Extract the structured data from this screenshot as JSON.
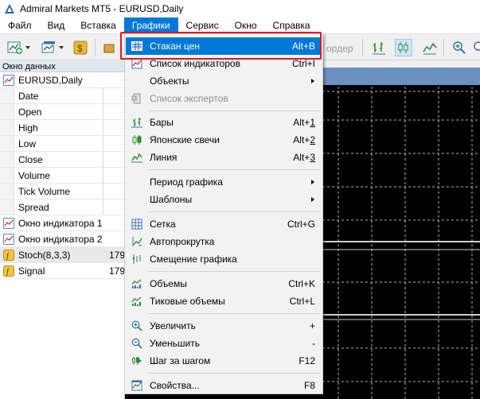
{
  "window": {
    "title": "Admiral Markets MT5 - EURUSD,Daily"
  },
  "menubar": {
    "items": [
      {
        "label": "Файл"
      },
      {
        "label": "Вид"
      },
      {
        "label": "Вставка"
      },
      {
        "label": "Графики"
      },
      {
        "label": "Сервис"
      },
      {
        "label": "Окно"
      },
      {
        "label": "Справка"
      }
    ]
  },
  "toolbar": {
    "order_label": "ордер"
  },
  "data_window": {
    "header": "Окно данных",
    "symbol": "EURUSD,Daily",
    "fields": [
      "Date",
      "Open",
      "High",
      "Low",
      "Close",
      "Volume",
      "Tick Volume",
      "Spread"
    ],
    "indicator_windows": [
      "Окно индикатора 1",
      "Окно индикатора 2"
    ],
    "stoch": {
      "label": "Stoch(8,3,3)",
      "value": "179"
    },
    "signal": {
      "label": "Signal",
      "value": "179"
    }
  },
  "chart_menu": {
    "items": [
      {
        "label": "Стакан цен",
        "shortcut": "Alt+B",
        "icon": "depth-of-market-icon"
      },
      {
        "label": "Список индикаторов",
        "shortcut": "Ctrl+I",
        "icon": "indicators-list-icon"
      },
      {
        "label": "Объекты",
        "submenu": true
      },
      {
        "label": "Список экспертов",
        "disabled": true,
        "icon": "experts-list-icon"
      },
      {
        "label": "Бары",
        "shortcut_prefix": "Alt+",
        "shortcut_key": "1",
        "icon": "bar-chart-icon"
      },
      {
        "label": "Японские свечи",
        "shortcut_prefix": "Alt+",
        "shortcut_key": "2",
        "icon": "candlestick-icon"
      },
      {
        "label": "Линия",
        "shortcut_prefix": "Alt+",
        "shortcut_key": "3",
        "icon": "line-chart-icon"
      },
      {
        "label": "Период графика",
        "submenu": true
      },
      {
        "label": "Шаблоны",
        "submenu": true
      },
      {
        "label": "Сетка",
        "shortcut": "Ctrl+G",
        "icon": "grid-icon"
      },
      {
        "label": "Автопрокрутка",
        "icon": "autoscroll-icon"
      },
      {
        "label": "Смещение графика",
        "icon": "chart-shift-icon"
      },
      {
        "label": "Объемы",
        "shortcut": "Ctrl+K",
        "icon": "volumes-icon"
      },
      {
        "label": "Тиковые объемы",
        "shortcut": "Ctrl+L",
        "icon": "tick-volumes-icon"
      },
      {
        "label": "Увеличить",
        "shortcut": "+",
        "icon": "zoom-in-icon"
      },
      {
        "label": "Уменьшить",
        "shortcut": "-",
        "icon": "zoom-out-icon"
      },
      {
        "label": "Шаг за шагом",
        "shortcut": "F12",
        "icon": "step-icon"
      },
      {
        "label": "Свойства...",
        "shortcut": "F8",
        "icon": "properties-icon"
      }
    ]
  }
}
